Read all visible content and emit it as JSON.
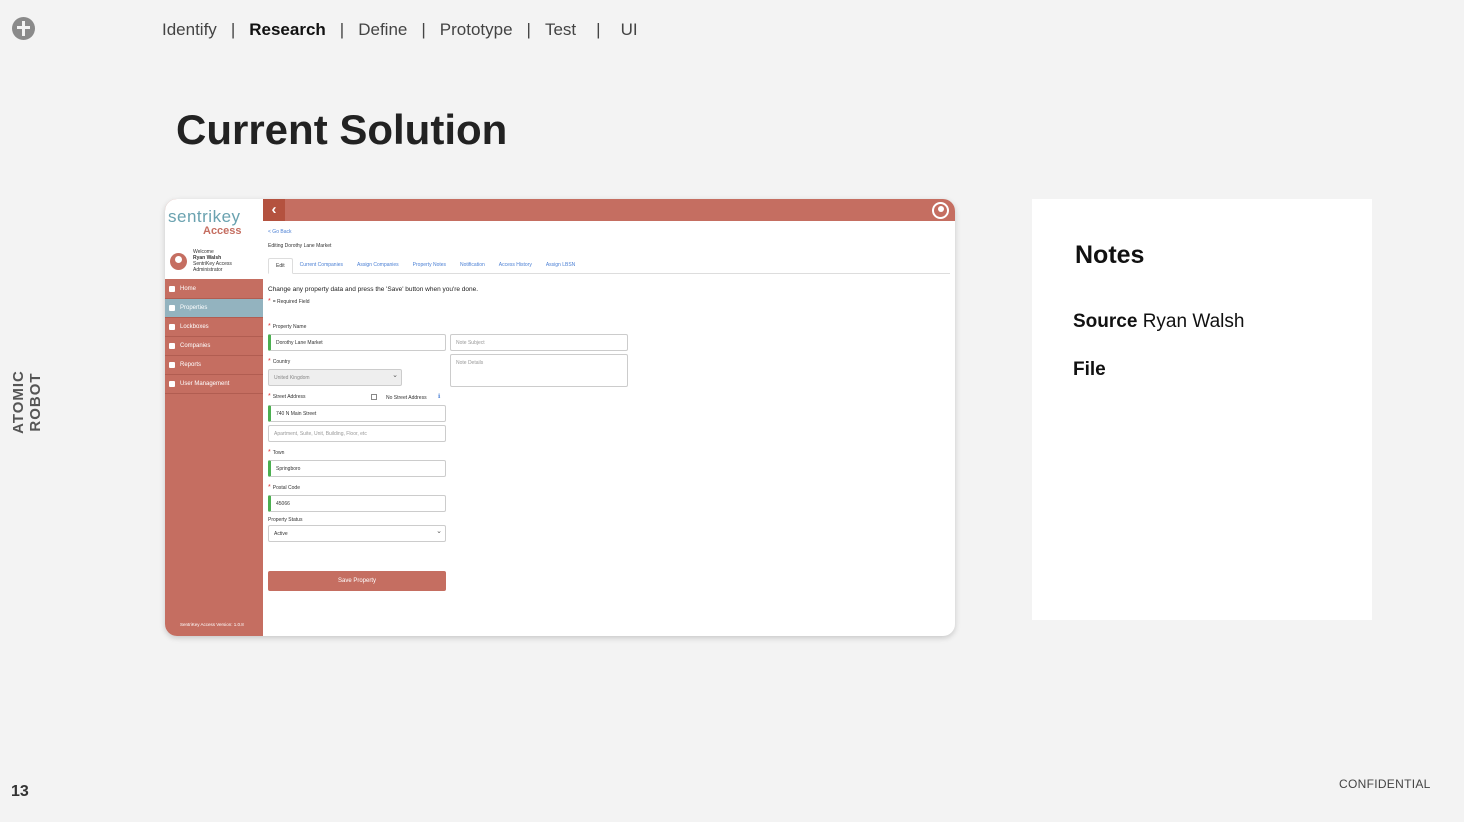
{
  "nav": {
    "items": [
      {
        "label": "Identify",
        "active": false
      },
      {
        "label": "Research",
        "active": true
      },
      {
        "label": "Define",
        "active": false
      },
      {
        "label": "Prototype",
        "active": false
      },
      {
        "label": "Test",
        "active": false
      },
      {
        "label": "UI",
        "active": false
      }
    ],
    "separator": "|"
  },
  "side_label": "ATOMIC ROBOT",
  "title": "Current Solution",
  "page_number": "13",
  "confidential": "CONFIDENTIAL",
  "notes": {
    "title": "Notes",
    "source_label": "Source",
    "source_value": "Ryan Walsh",
    "file_label": "File"
  },
  "app": {
    "brand": "sentrikey",
    "brand_sub": "Access",
    "welcome": "Welcome",
    "user_name": "Ryan Walsh",
    "user_org": "SentriKey Access",
    "user_role": "Administrator",
    "menu": [
      {
        "label": "Home",
        "active": false
      },
      {
        "label": "Properties",
        "active": true
      },
      {
        "label": "Lockboxes",
        "active": false
      },
      {
        "label": "Companies",
        "active": false
      },
      {
        "label": "Reports",
        "active": false
      },
      {
        "label": "User Management",
        "active": false
      }
    ],
    "version": "SentriKey Access Version: 1.0.8",
    "go_back": "< Go Back",
    "editing": "Editing Dorothy Lane Market",
    "tabs": [
      "Edit",
      "Current Companies",
      "Assign Companies",
      "Property Notes",
      "Notification",
      "Access History",
      "Assign LBSN"
    ],
    "instructions": "Change any property data and press the 'Save' button when you're done.",
    "required_note": "= Required Field",
    "form": {
      "property_name_label": "Property Name",
      "property_name_value": "Dorothy Lane Market",
      "note_subject_placeholder": "Note Subject",
      "note_details_placeholder": "Note Details",
      "country_label": "Country",
      "country_value": "United Kingdom",
      "street_label": "Street Address",
      "no_street_label": "No Street Address",
      "street_value": "740 N Main Street",
      "street2_placeholder": "Apartment, Suite, Unit, Building, Floor, etc",
      "town_label": "Town",
      "town_value": "Springboro",
      "postal_label": "Postal Code",
      "postal_value": "45066",
      "status_label": "Property Status",
      "status_value": "Active",
      "save_label": "Save Property"
    }
  }
}
